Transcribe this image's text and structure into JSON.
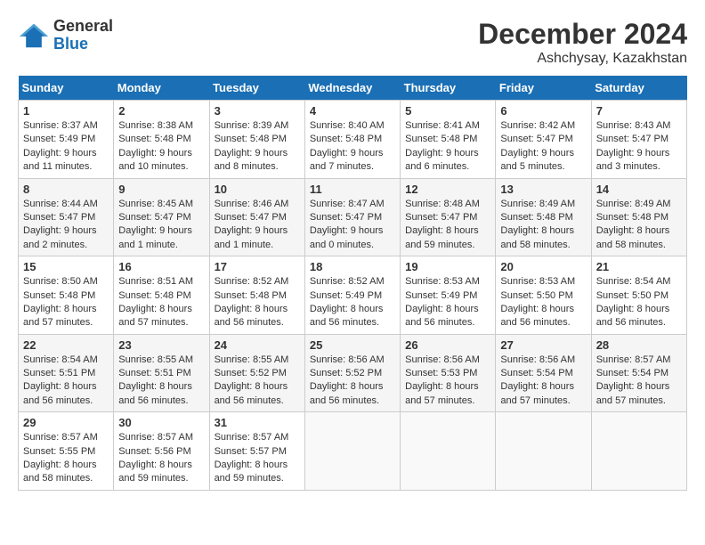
{
  "header": {
    "logo_line1": "General",
    "logo_line2": "Blue",
    "month_year": "December 2024",
    "location": "Ashchysay, Kazakhstan"
  },
  "days_of_week": [
    "Sunday",
    "Monday",
    "Tuesday",
    "Wednesday",
    "Thursday",
    "Friday",
    "Saturday"
  ],
  "weeks": [
    [
      {
        "day": 1,
        "sunrise": "8:37 AM",
        "sunset": "5:49 PM",
        "daylight": "9 hours and 11 minutes."
      },
      {
        "day": 2,
        "sunrise": "8:38 AM",
        "sunset": "5:48 PM",
        "daylight": "9 hours and 10 minutes."
      },
      {
        "day": 3,
        "sunrise": "8:39 AM",
        "sunset": "5:48 PM",
        "daylight": "9 hours and 8 minutes."
      },
      {
        "day": 4,
        "sunrise": "8:40 AM",
        "sunset": "5:48 PM",
        "daylight": "9 hours and 7 minutes."
      },
      {
        "day": 5,
        "sunrise": "8:41 AM",
        "sunset": "5:48 PM",
        "daylight": "9 hours and 6 minutes."
      },
      {
        "day": 6,
        "sunrise": "8:42 AM",
        "sunset": "5:47 PM",
        "daylight": "9 hours and 5 minutes."
      },
      {
        "day": 7,
        "sunrise": "8:43 AM",
        "sunset": "5:47 PM",
        "daylight": "9 hours and 3 minutes."
      }
    ],
    [
      {
        "day": 8,
        "sunrise": "8:44 AM",
        "sunset": "5:47 PM",
        "daylight": "9 hours and 2 minutes."
      },
      {
        "day": 9,
        "sunrise": "8:45 AM",
        "sunset": "5:47 PM",
        "daylight": "9 hours and 1 minute."
      },
      {
        "day": 10,
        "sunrise": "8:46 AM",
        "sunset": "5:47 PM",
        "daylight": "9 hours and 1 minute."
      },
      {
        "day": 11,
        "sunrise": "8:47 AM",
        "sunset": "5:47 PM",
        "daylight": "9 hours and 0 minutes."
      },
      {
        "day": 12,
        "sunrise": "8:48 AM",
        "sunset": "5:47 PM",
        "daylight": "8 hours and 59 minutes."
      },
      {
        "day": 13,
        "sunrise": "8:49 AM",
        "sunset": "5:48 PM",
        "daylight": "8 hours and 58 minutes."
      },
      {
        "day": 14,
        "sunrise": "8:49 AM",
        "sunset": "5:48 PM",
        "daylight": "8 hours and 58 minutes."
      }
    ],
    [
      {
        "day": 15,
        "sunrise": "8:50 AM",
        "sunset": "5:48 PM",
        "daylight": "8 hours and 57 minutes."
      },
      {
        "day": 16,
        "sunrise": "8:51 AM",
        "sunset": "5:48 PM",
        "daylight": "8 hours and 57 minutes."
      },
      {
        "day": 17,
        "sunrise": "8:52 AM",
        "sunset": "5:48 PM",
        "daylight": "8 hours and 56 minutes."
      },
      {
        "day": 18,
        "sunrise": "8:52 AM",
        "sunset": "5:49 PM",
        "daylight": "8 hours and 56 minutes."
      },
      {
        "day": 19,
        "sunrise": "8:53 AM",
        "sunset": "5:49 PM",
        "daylight": "8 hours and 56 minutes."
      },
      {
        "day": 20,
        "sunrise": "8:53 AM",
        "sunset": "5:50 PM",
        "daylight": "8 hours and 56 minutes."
      },
      {
        "day": 21,
        "sunrise": "8:54 AM",
        "sunset": "5:50 PM",
        "daylight": "8 hours and 56 minutes."
      }
    ],
    [
      {
        "day": 22,
        "sunrise": "8:54 AM",
        "sunset": "5:51 PM",
        "daylight": "8 hours and 56 minutes."
      },
      {
        "day": 23,
        "sunrise": "8:55 AM",
        "sunset": "5:51 PM",
        "daylight": "8 hours and 56 minutes."
      },
      {
        "day": 24,
        "sunrise": "8:55 AM",
        "sunset": "5:52 PM",
        "daylight": "8 hours and 56 minutes."
      },
      {
        "day": 25,
        "sunrise": "8:56 AM",
        "sunset": "5:52 PM",
        "daylight": "8 hours and 56 minutes."
      },
      {
        "day": 26,
        "sunrise": "8:56 AM",
        "sunset": "5:53 PM",
        "daylight": "8 hours and 57 minutes."
      },
      {
        "day": 27,
        "sunrise": "8:56 AM",
        "sunset": "5:54 PM",
        "daylight": "8 hours and 57 minutes."
      },
      {
        "day": 28,
        "sunrise": "8:57 AM",
        "sunset": "5:54 PM",
        "daylight": "8 hours and 57 minutes."
      }
    ],
    [
      {
        "day": 29,
        "sunrise": "8:57 AM",
        "sunset": "5:55 PM",
        "daylight": "8 hours and 58 minutes."
      },
      {
        "day": 30,
        "sunrise": "8:57 AM",
        "sunset": "5:56 PM",
        "daylight": "8 hours and 59 minutes."
      },
      {
        "day": 31,
        "sunrise": "8:57 AM",
        "sunset": "5:57 PM",
        "daylight": "8 hours and 59 minutes."
      },
      null,
      null,
      null,
      null
    ]
  ]
}
